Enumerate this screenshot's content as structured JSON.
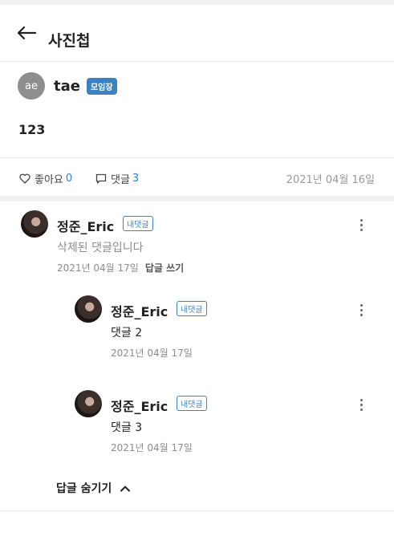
{
  "header": {
    "title": "사진첩"
  },
  "post": {
    "author_initials": "ae",
    "author_name": "tae",
    "author_badge": "모임장",
    "body": "123",
    "like_label": "좋아요",
    "like_count": "0",
    "comment_label": "댓글",
    "comment_count": "3",
    "date": "2021년 04월 16일"
  },
  "comments": [
    {
      "name": "정준_Eric",
      "badge": "내댓글",
      "text": "삭제된 댓글입니다",
      "date": "2021년 04월 17일",
      "reply_label": "답글 쓰기"
    },
    {
      "name": "정준_Eric",
      "badge": "내댓글",
      "text": "댓글 2",
      "date": "2021년 04월 17일"
    },
    {
      "name": "정준_Eric",
      "badge": "내댓글",
      "text": "댓글 3",
      "date": "2021년 04월 17일"
    }
  ],
  "hide_replies_label": "답글 숨기기",
  "colors": {
    "accent": "#3b82c4",
    "count": "#2a7fd0",
    "muted": "#8c8c8c"
  },
  "icons": [
    "back-arrow-icon",
    "heart-icon",
    "comment-icon",
    "kebab-menu-icon",
    "chevron-up-icon"
  ]
}
